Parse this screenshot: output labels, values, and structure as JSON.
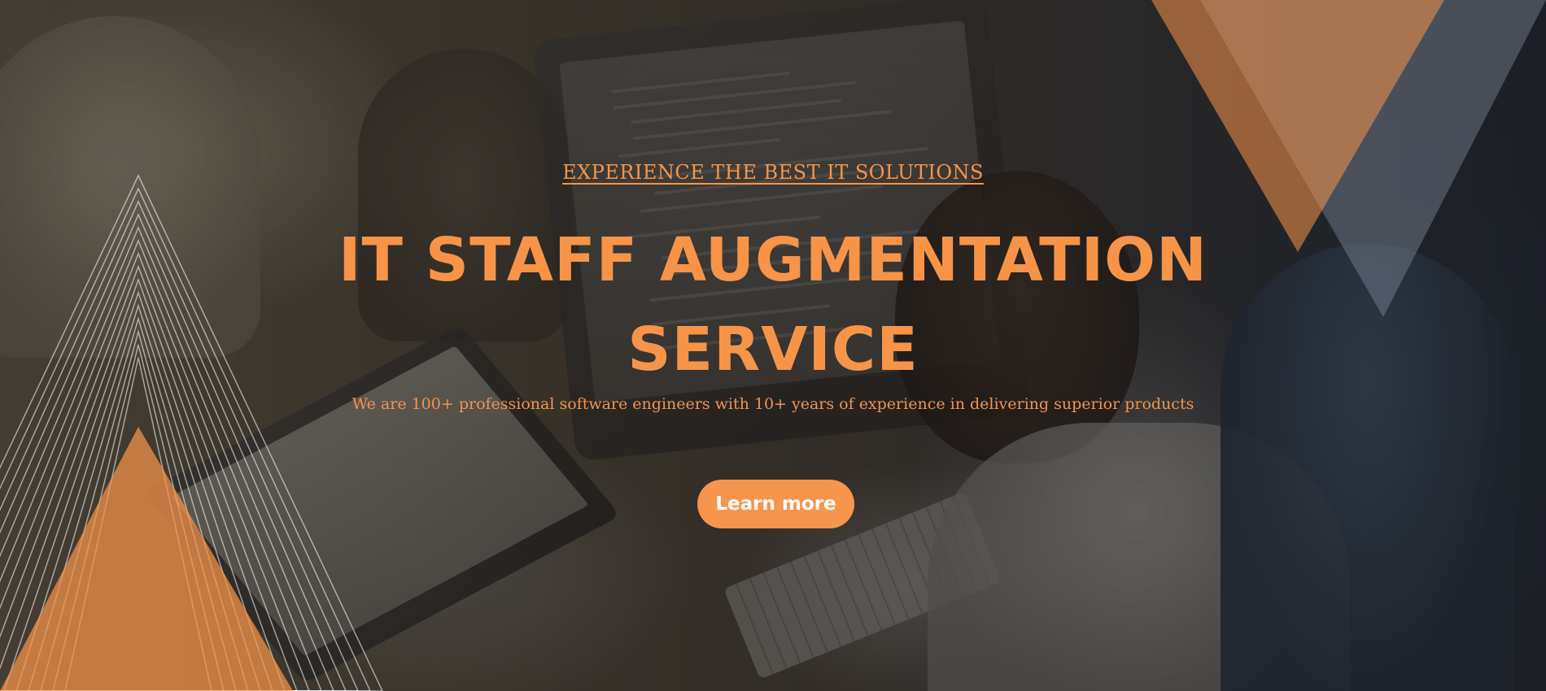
{
  "hero": {
    "eyebrow": "EXPERIENCE THE BEST IT SOLUTIONS",
    "title_line1": "IT STAFF AUGMENTATION",
    "title_line2": "SERVICE",
    "subtitle": "We are 100+ professional software engineers with 10+ years of experience in delivering superior products",
    "cta_label": "Learn more",
    "background_image": "team-working-on-computers-photo"
  },
  "colors": {
    "accent": "#f79448",
    "button_bg": "#f7954d",
    "button_text": "#ffffff",
    "overlay": "#1c1814"
  }
}
